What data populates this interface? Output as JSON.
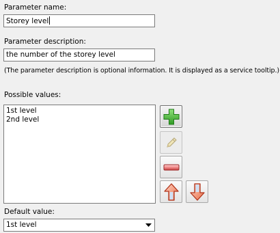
{
  "name": {
    "label": "Parameter name:",
    "value": "Storey level"
  },
  "description": {
    "label": "Parameter description:",
    "value": "the number of the storey level",
    "hint": "(The parameter description is optional information. It is displayed as a service tooltip.)"
  },
  "values": {
    "label": "Possible values:",
    "items": [
      "1st level",
      "2nd level"
    ]
  },
  "toolbar": {
    "add_icon": "plus-icon",
    "edit_icon": "pencil-icon",
    "remove_icon": "minus-icon",
    "up_icon": "arrow-up-icon",
    "down_icon": "arrow-down-icon"
  },
  "default": {
    "label": "Default value:",
    "value": "1st level"
  }
}
